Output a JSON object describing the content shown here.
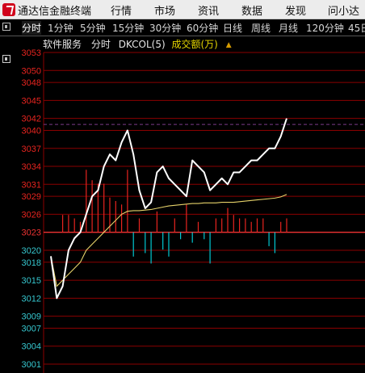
{
  "window": {
    "title": "通达信金融终端"
  },
  "menu": [
    "行情",
    "市场",
    "资讯",
    "数据",
    "发现",
    "问小达"
  ],
  "periods": [
    "分时",
    "1分钟",
    "5分钟",
    "15分钟",
    "30分钟",
    "60分钟",
    "日线",
    "周线",
    "月线",
    "120分钟",
    "45日"
  ],
  "active_period": "分时",
  "info": {
    "name": "软件服务",
    "period": "分时",
    "indicator": "DKCOL(5)",
    "volume_label": "成交额(万)"
  },
  "colors": {
    "up": "#e8241f",
    "down": "#00c8d2",
    "down_label": "#36c7cf",
    "grid": "#8b0000",
    "price_line": "#ffffff",
    "avg_line": "#e6d26a",
    "prev_close_line": "#7c3a8a",
    "vol_label": "#e4d500"
  },
  "icons": {
    "logo": "tdx-logo",
    "sort": "sort-icon",
    "toggle": "panel-toggle-icon"
  },
  "chart_data": {
    "type": "line",
    "y_ticks": [
      3053,
      3050,
      3048,
      3045,
      3042,
      3040,
      3037,
      3034,
      3031,
      3029,
      3026,
      3023,
      3020,
      3018,
      3015,
      3012,
      3009,
      3007,
      3004,
      3001
    ],
    "ylim": [
      3001,
      3053
    ],
    "prev_close": 3023,
    "reference_level": 3041,
    "price": [
      3019,
      3012,
      3014,
      3020,
      3022,
      3023,
      3026,
      3029,
      3030,
      3034,
      3036,
      3035,
      3038,
      3040,
      3036,
      3030,
      3027,
      3028,
      3033,
      3034,
      3032,
      3031,
      3030,
      3029,
      3035,
      3034,
      3033,
      3030,
      3031,
      3032,
      3031,
      3033,
      3033,
      3034,
      3035,
      3035,
      3036,
      3037,
      3037,
      3039,
      3042
    ],
    "average": [
      3019,
      3014,
      3015,
      3016,
      3017,
      3018,
      3020,
      3021,
      3022,
      3023,
      3024,
      3025,
      3026,
      3026.5,
      3026.6,
      3026.6,
      3026.7,
      3026.8,
      3027,
      3027.2,
      3027.4,
      3027.5,
      3027.6,
      3027.7,
      3027.8,
      3027.8,
      3027.9,
      3027.9,
      3027.9,
      3028,
      3028,
      3028,
      3028.1,
      3028.2,
      3028.3,
      3028.4,
      3028.5,
      3028.6,
      3028.7,
      3028.9,
      3029.3
    ],
    "dkcol": [
      0,
      0,
      5,
      5,
      4,
      3,
      18,
      15,
      14,
      14,
      10,
      9,
      8,
      18,
      -7,
      4,
      -6,
      -9,
      6,
      -5,
      -7,
      4,
      -2,
      8,
      -3,
      3,
      -2,
      -9,
      4,
      4,
      7,
      5,
      4,
      4,
      3,
      4,
      4,
      -4,
      -6,
      3,
      4
    ]
  }
}
